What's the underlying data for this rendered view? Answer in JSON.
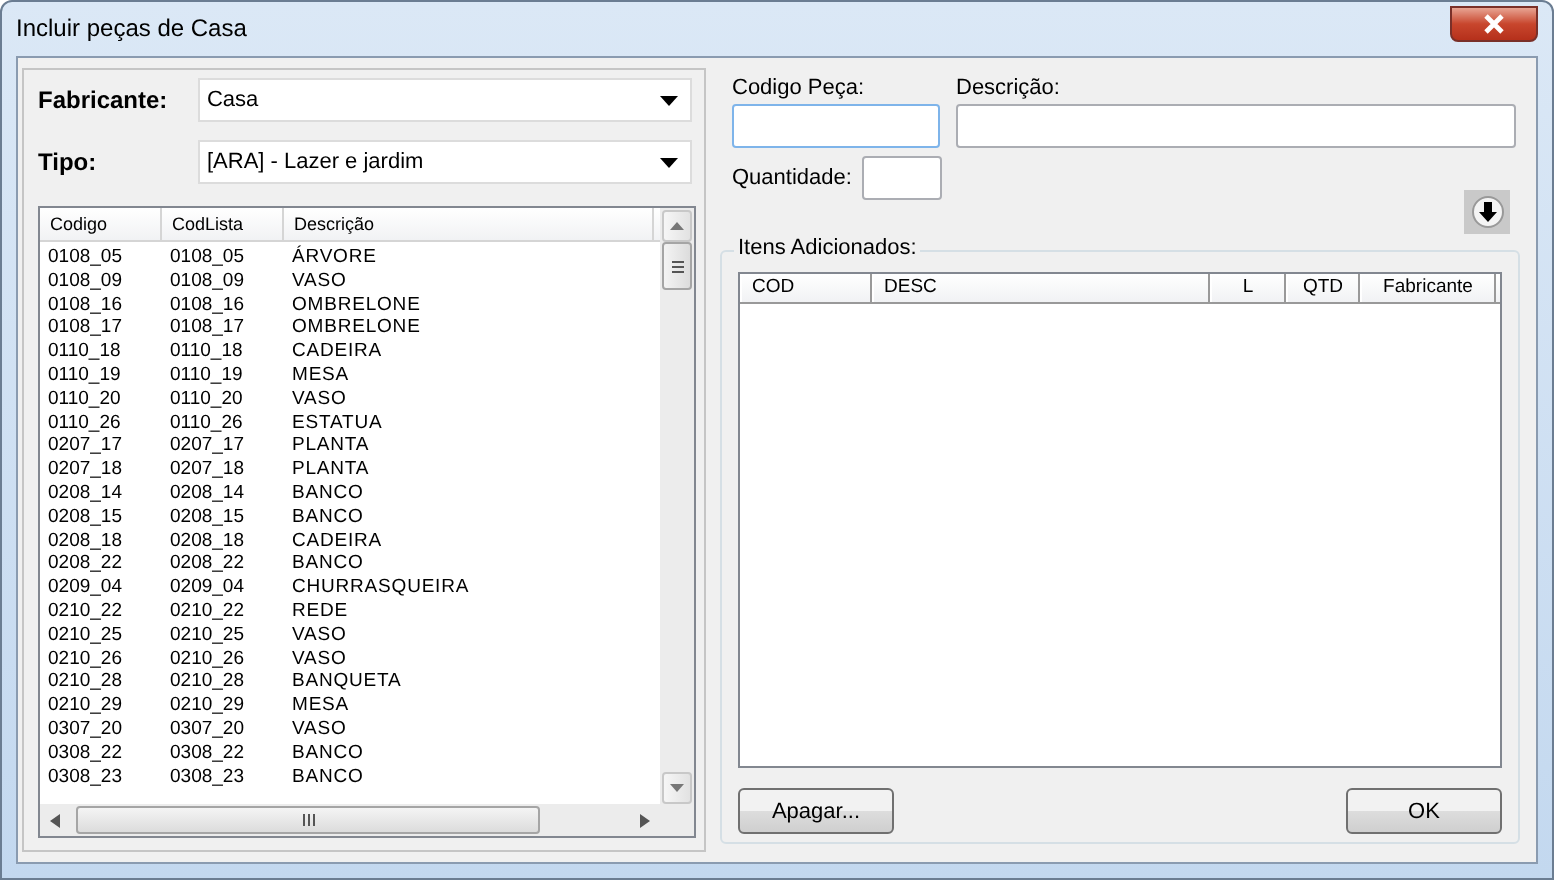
{
  "window": {
    "title": "Incluir peças de Casa"
  },
  "filters": [
    {
      "label": "Fabricante:",
      "value": "Casa"
    },
    {
      "label": "Tipo:",
      "value": "[ARA] - Lazer e jardim"
    }
  ],
  "parts_list": {
    "columns": [
      "Codigo",
      "CodLista",
      "Descrição"
    ],
    "rows": [
      [
        "0108_05",
        "0108_05",
        "ÁRVORE"
      ],
      [
        "0108_09",
        "0108_09",
        "VASO"
      ],
      [
        "0108_16",
        "0108_16",
        "OMBRELONE"
      ],
      [
        "0108_17",
        "0108_17",
        "OMBRELONE"
      ],
      [
        "0110_18",
        "0110_18",
        "CADEIRA"
      ],
      [
        "0110_19",
        "0110_19",
        "MESA"
      ],
      [
        "0110_20",
        "0110_20",
        "VASO"
      ],
      [
        "0110_26",
        "0110_26",
        "ESTATUA"
      ],
      [
        "0207_17",
        "0207_17",
        "PLANTA"
      ],
      [
        "0207_18",
        "0207_18",
        "PLANTA"
      ],
      [
        "0208_14",
        "0208_14",
        "BANCO"
      ],
      [
        "0208_15",
        "0208_15",
        "BANCO"
      ],
      [
        "0208_18",
        "0208_18",
        "CADEIRA"
      ],
      [
        "0208_22",
        "0208_22",
        "BANCO"
      ],
      [
        "0209_04",
        "0209_04",
        "CHURRASQUEIRA"
      ],
      [
        "0210_22",
        "0210_22",
        "REDE"
      ],
      [
        "0210_25",
        "0210_25",
        "VASO"
      ],
      [
        "0210_26",
        "0210_26",
        "VASO"
      ],
      [
        "0210_28",
        "0210_28",
        "BANQUETA"
      ],
      [
        "0210_29",
        "0210_29",
        "MESA"
      ],
      [
        "0307_20",
        "0307_20",
        "VASO"
      ],
      [
        "0308_22",
        "0308_22",
        "BANCO"
      ],
      [
        "0308_23",
        "0308_23",
        "BANCO"
      ]
    ]
  },
  "code_field": {
    "label": "Codigo Peça:"
  },
  "description_field": {
    "label": "Descrição:"
  },
  "quantity_field": {
    "label": "Quantidade:"
  },
  "added_items": {
    "title": "Itens Adicionados:",
    "columns": [
      "COD",
      "DESC",
      "L",
      "QTD",
      "Fabricante"
    ]
  },
  "buttons": {
    "delete": "Apagar...",
    "ok": "OK"
  }
}
